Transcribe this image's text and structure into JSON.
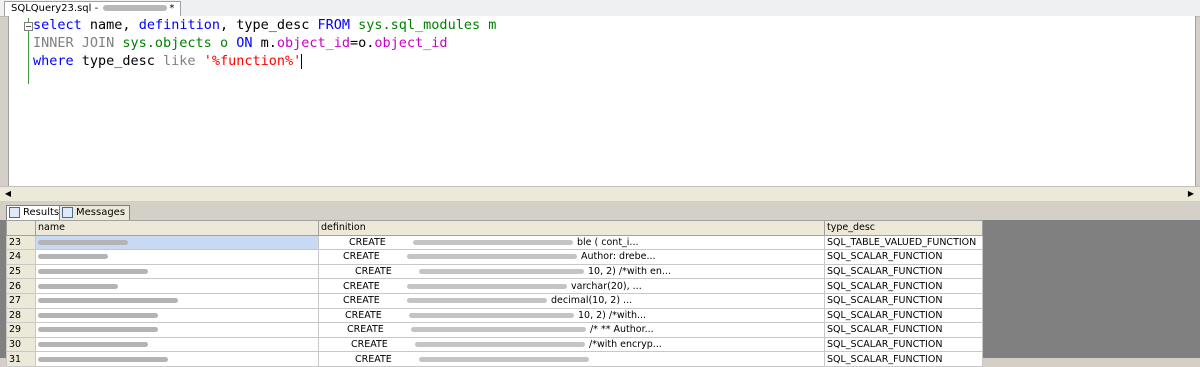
{
  "document_tab": {
    "title_prefix": "SQLQuery23.sql - ",
    "title_suffix": "*"
  },
  "editor": {
    "line1": {
      "kw1": "select",
      "cols": " name, ",
      "kw2": "definition",
      "mid": ", type_desc ",
      "kw3": "FROM",
      "tbl": " sys.sql_modules m"
    },
    "line2": {
      "kw1": "INNER JOIN",
      "tbl": " sys.objects o ",
      "kw2": "ON",
      "cond1": " m.",
      "fld1": "object_id",
      "eq": "=o.",
      "fld2": "object_id"
    },
    "line3": {
      "kw1": "where",
      "col": " type_desc ",
      "op": "like",
      "sp": " ",
      "str": "'%function%'"
    }
  },
  "results_tabs": {
    "results_label": "Results",
    "messages_label": "Messages"
  },
  "grid": {
    "columns": [
      "name",
      "definition",
      "type_desc"
    ],
    "rows": [
      {
        "n": "23",
        "def_create": "CREATE",
        "def_tail": "ble (    cont_i...",
        "type": "SQL_TABLE_VALUED_FUNCTION"
      },
      {
        "n": "24",
        "def_create": "CREATE",
        "def_tail": "Author: drebe...",
        "type": "SQL_SCALAR_FUNCTION"
      },
      {
        "n": "25",
        "def_create": "CREATE",
        "def_tail": "10, 2)  /*with en...",
        "type": "SQL_SCALAR_FUNCTION"
      },
      {
        "n": "26",
        "def_create": "CREATE",
        "def_tail": "varchar(20), ...",
        "type": "SQL_SCALAR_FUNCTION"
      },
      {
        "n": "27",
        "def_create": "CREATE",
        "def_tail": "decimal(10, 2) ...",
        "type": "SQL_SCALAR_FUNCTION"
      },
      {
        "n": "28",
        "def_create": "CREATE",
        "def_tail": "10, 2)   /*with...",
        "type": "SQL_SCALAR_FUNCTION"
      },
      {
        "n": "29",
        "def_create": "CREATE",
        "def_tail": "/* ** Author...",
        "type": "SQL_SCALAR_FUNCTION"
      },
      {
        "n": "30",
        "def_create": "CREATE",
        "def_tail": "/*with encryp...",
        "type": "SQL_SCALAR_FUNCTION"
      },
      {
        "n": "31",
        "def_create": "CREATE",
        "def_tail": "",
        "type": "SQL_SCALAR_FUNCTION"
      }
    ]
  }
}
